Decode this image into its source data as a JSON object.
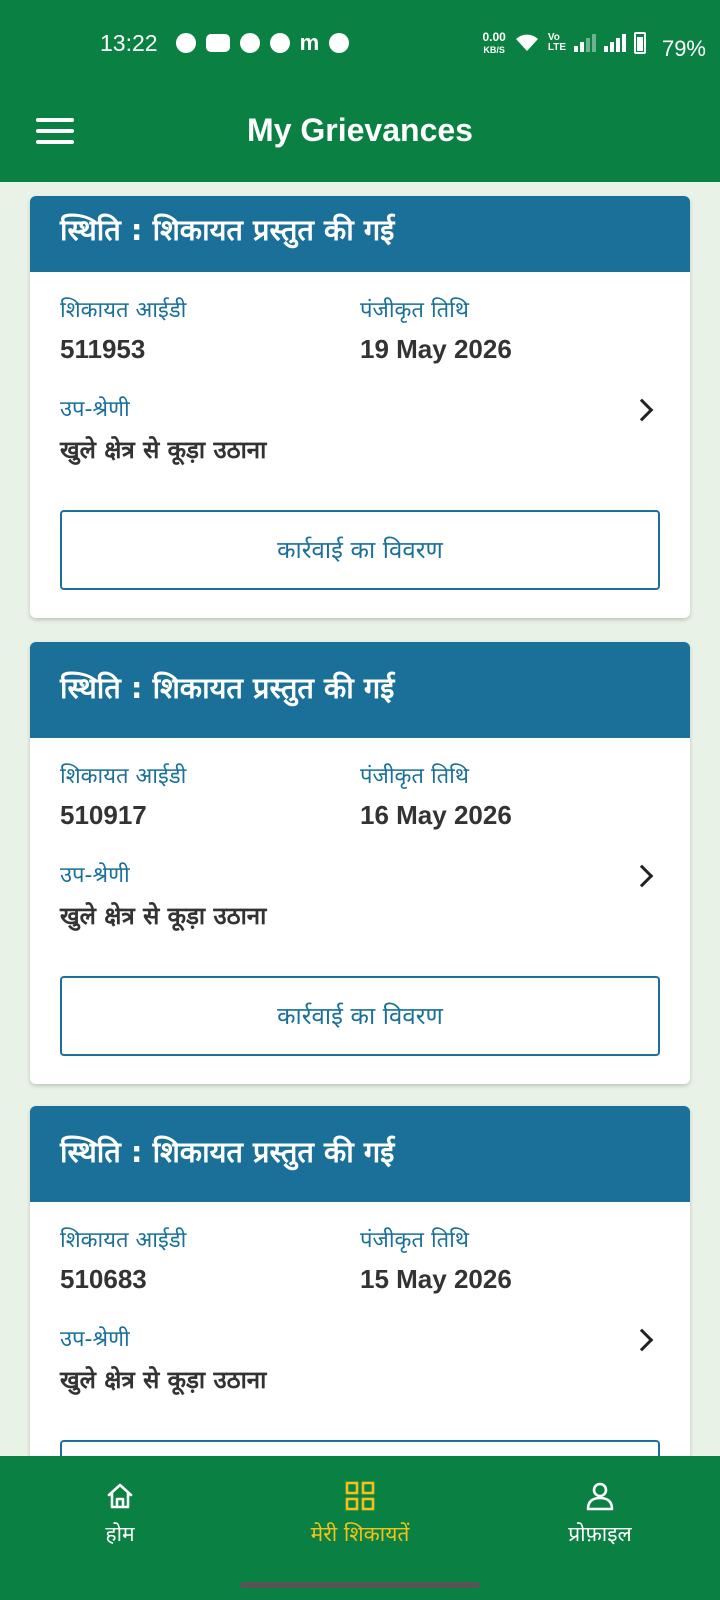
{
  "status_bar": {
    "time": "13:22",
    "net_speed_top": "0.00",
    "net_speed_bottom": "KB/S",
    "battery": "79%"
  },
  "app_bar": {
    "title": "My Grievances"
  },
  "labels": {
    "id_label": "शिकायत आईडी",
    "date_label": "पंजीकृत तिथि",
    "subcategory_label": "उप-श्रेणी",
    "action_button": "कार्रवाई का विवरण"
  },
  "grievances": [
    {
      "status": "स्थिति : शिकायत प्रस्तुत की गई",
      "id": "511953",
      "date": "19 May 2026",
      "subcategory": "खुले क्षेत्र से कूड़ा उठाना"
    },
    {
      "status": "स्थिति : शिकायत प्रस्तुत की गई",
      "id": "510917",
      "date": "16 May 2026",
      "subcategory": "खुले क्षेत्र से कूड़ा उठाना"
    },
    {
      "status": "स्थिति : शिकायत प्रस्तुत की गई",
      "id": "510683",
      "date": "15 May 2026",
      "subcategory": "खुले क्षेत्र से कूड़ा उठाना"
    }
  ],
  "bottom_nav": {
    "items": [
      {
        "label": "होम",
        "icon": "home-icon",
        "active": false
      },
      {
        "label": "मेरी शिकायतें",
        "icon": "grid-icon",
        "active": true
      },
      {
        "label": "प्रोफ़ाइल",
        "icon": "person-icon",
        "active": false
      }
    ]
  },
  "colors": {
    "brand_green": "#0b8043",
    "card_header_blue": "#1a7099",
    "active_nav": "#f0c419",
    "background": "#e8f2e6"
  }
}
